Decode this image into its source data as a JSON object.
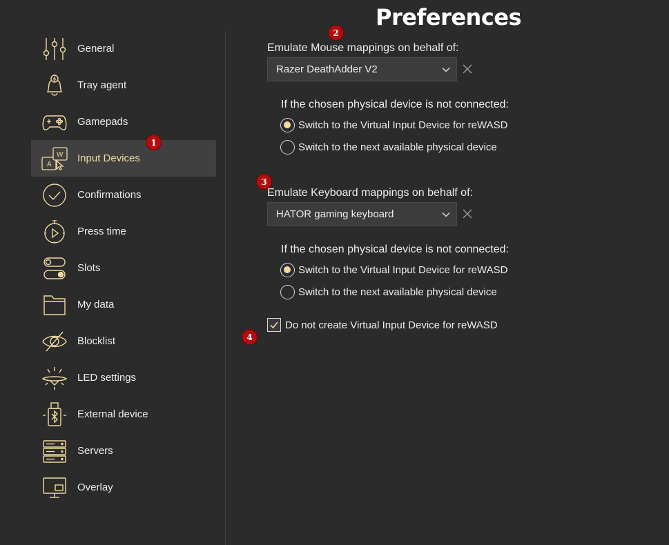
{
  "window": {
    "title": "Preferences"
  },
  "colors": {
    "accent": "#f2d9a0",
    "badge": "#b30d0d",
    "background": "#2b2b2b",
    "active_item": "#404040"
  },
  "sidebar": {
    "items": [
      {
        "label": "General",
        "icon": "sliders-icon"
      },
      {
        "label": "Tray agent",
        "icon": "bell-icon"
      },
      {
        "label": "Gamepads",
        "icon": "gamepad-icon"
      },
      {
        "label": "Input Devices",
        "icon": "keyboard-mouse-icon",
        "active": true
      },
      {
        "label": "Confirmations",
        "icon": "check-circle-icon"
      },
      {
        "label": "Press time",
        "icon": "stopwatch-icon"
      },
      {
        "label": "Slots",
        "icon": "toggles-icon"
      },
      {
        "label": "My data",
        "icon": "folder-icon"
      },
      {
        "label": "Blocklist",
        "icon": "eye-off-icon"
      },
      {
        "label": "LED settings",
        "icon": "led-icon"
      },
      {
        "label": "External device",
        "icon": "bluetooth-usb-icon"
      },
      {
        "label": "Servers",
        "icon": "server-icon"
      },
      {
        "label": "Overlay",
        "icon": "monitor-icon"
      }
    ]
  },
  "badges": {
    "b1": "1",
    "b2": "2",
    "b3": "3",
    "b4": "4"
  },
  "mouse": {
    "label": "Emulate Mouse mappings on behalf of:",
    "selected": "Razer DeathAdder V2",
    "fallback_label": "If the chosen physical device is not connected:",
    "options": [
      "Switch to the Virtual Input Device for reWASD",
      "Switch to the next available physical device"
    ],
    "selected_option": 0
  },
  "keyboard": {
    "label": "Emulate Keyboard mappings on behalf of:",
    "selected": "HATOR gaming keyboard",
    "fallback_label": "If the chosen physical device is not connected:",
    "options": [
      "Switch to the Virtual Input Device for reWASD",
      "Switch to the next available physical device"
    ],
    "selected_option": 0
  },
  "no_virtual": {
    "label": "Do not create Virtual Input Device for reWASD",
    "checked": true
  }
}
